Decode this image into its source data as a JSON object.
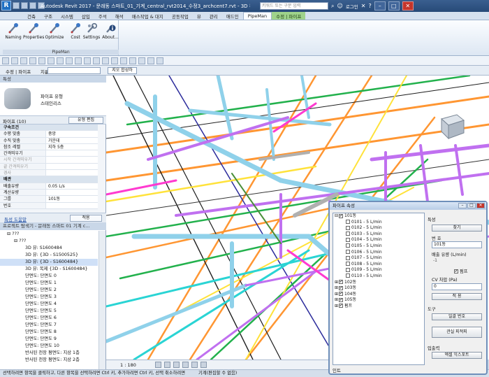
{
  "app": {
    "logo": "R",
    "title": "Autodesk Revit 2017 -    문래동 스마트_01_기계_central_rvt2014_수정3_archcent7.rvt - 3D 뷰: {3D - S1600484}",
    "search_placeholder": "키워드 또는 구문 입력",
    "user": "로그인",
    "help": "?"
  },
  "tabs": [
    "건축",
    "구조",
    "시스템",
    "삽입",
    "주석",
    "해석",
    "매스작업 & 대지",
    "공동작업",
    "뷰",
    "관리",
    "애드인",
    "PipeMan",
    "수정 | 파이프"
  ],
  "active_tab_index": 11,
  "ribbon": {
    "buttons": [
      {
        "label": "Naming",
        "icon": "wrench-icon"
      },
      {
        "label": "Properties",
        "icon": "wrench-icon"
      },
      {
        "label": "Optimize",
        "icon": "wrench-icon"
      },
      {
        "label": "Cost",
        "icon": "wrench-icon"
      },
      {
        "label": "Settings",
        "icon": "gears-icon"
      },
      {
        "label": "About...",
        "icon": "info-icon"
      }
    ],
    "panel_title": "PipeMan"
  },
  "options_bar": {
    "label": "수정 | 파이프",
    "select_label": "지름:",
    "view_button": "지오 합성하"
  },
  "properties": {
    "header": "특성",
    "type_name_1": "파이프 유형",
    "type_name_2": "스테인리스",
    "selector": "파이프 (10)",
    "edit_type": "유형 편집",
    "rows": [
      {
        "k": "구속조건",
        "v": "",
        "group": true
      },
      {
        "k": "수평 맞춤",
        "v": "중앙"
      },
      {
        "k": "수직 맞춤",
        "v": "가운데"
      },
      {
        "k": "참조 레벨",
        "v": "지하 5층"
      },
      {
        "k": "간격띄우기",
        "v": ""
      },
      {
        "k": "시작 간격띄우기",
        "v": "",
        "dim": true
      },
      {
        "k": "끝 간격띄우기",
        "v": "",
        "dim": true
      },
      {
        "k": "경사",
        "v": "",
        "dim": true
      },
      {
        "k": "배관",
        "v": "",
        "group": true
      },
      {
        "k": "배출유량",
        "v": "0.05 L/s"
      },
      {
        "k": "계산유량",
        "v": ""
      },
      {
        "k": "그룹",
        "v": "101동"
      },
      {
        "k": "번호",
        "v": ""
      }
    ],
    "help_link": "특성 도움말",
    "apply": "적용"
  },
  "browser": {
    "title": "프로젝트 탐색기 - 문래동 스마트 01 기계 c...",
    "items": [
      {
        "label": "??? ",
        "indent": 10,
        "prefix": "⊟"
      },
      {
        "label": "???",
        "indent": 20,
        "prefix": "⊟"
      },
      {
        "label": "3D 뷰: S1600484",
        "indent": 36
      },
      {
        "label": "3D 뷰: {3D - S1500525}",
        "indent": 36
      },
      {
        "label": "3D 뷰: {3D - S1600484}",
        "indent": 36,
        "sel": true
      },
      {
        "label": "3D 뷰: 복제 {3D - S1600484}",
        "indent": 36
      },
      {
        "label": "단면도: 단면도 0",
        "indent": 36
      },
      {
        "label": "단면도: 단면도 1",
        "indent": 36
      },
      {
        "label": "단면도: 단면도 2",
        "indent": 36
      },
      {
        "label": "단면도: 단면도 3",
        "indent": 36
      },
      {
        "label": "단면도: 단면도 4",
        "indent": 36
      },
      {
        "label": "단면도: 단면도 5",
        "indent": 36
      },
      {
        "label": "단면도: 단면도 6",
        "indent": 36
      },
      {
        "label": "단면도: 단면도 7",
        "indent": 36
      },
      {
        "label": "단면도: 단면도 8",
        "indent": 36
      },
      {
        "label": "단면도: 단면도 9",
        "indent": 36
      },
      {
        "label": "단면도: 단면도 10",
        "indent": 36
      },
      {
        "label": "반사된 천장 평면도: 지상 1층",
        "indent": 36
      },
      {
        "label": "반사된 천장 평면도: 지상 2층",
        "indent": 36
      }
    ]
  },
  "view": {
    "scale": "1 : 180"
  },
  "status": {
    "text": "선택하려면 항목을 클릭하고, 다른 항목을 선택하려면 Ctrl 키, 추가하려면 Ctrl 키, 선택 취소하려면",
    "right": "기계(편집할 수 없음)"
  },
  "pipeman_dialog": {
    "title": "파이프 속성",
    "tree": [
      {
        "label": "101동",
        "indent": 2,
        "exp": "⊟",
        "checked": true
      },
      {
        "label": "0101 - 5 L/min",
        "indent": 18,
        "checked": false
      },
      {
        "label": "0102 - 5 L/min",
        "indent": 18,
        "checked": false
      },
      {
        "label": "0103 - 5 L/min",
        "indent": 18,
        "checked": false
      },
      {
        "label": "0104 - 5 L/min",
        "indent": 18,
        "checked": false
      },
      {
        "label": "0105 - 5 L/min",
        "indent": 18,
        "checked": false
      },
      {
        "label": "0106 - 5 L/min",
        "indent": 18,
        "checked": false
      },
      {
        "label": "0107 - 5 L/min",
        "indent": 18,
        "checked": false
      },
      {
        "label": "0108 - 5 L/min",
        "indent": 18,
        "checked": false
      },
      {
        "label": "0109 - 5 L/min",
        "indent": 18,
        "checked": false
      },
      {
        "label": "0110 - 5 L/min",
        "indent": 18,
        "checked": false
      },
      {
        "label": "102동",
        "indent": 2,
        "exp": "⊞",
        "checked": true
      },
      {
        "label": "103동",
        "indent": 2,
        "exp": "⊞",
        "checked": true
      },
      {
        "label": "104동",
        "indent": 2,
        "exp": "⊞",
        "checked": true
      },
      {
        "label": "105동",
        "indent": 2,
        "exp": "⊞",
        "checked": true
      },
      {
        "label": "펌프",
        "indent": 2,
        "exp": "⊞",
        "checked": true
      }
    ],
    "footer": "인트",
    "side": {
      "section_props": "특성",
      "find_btn": "찾기",
      "number_label": "번 호",
      "number_value": "101동",
      "flow_label": "배출 유량 (L/min)",
      "flow_value": "-1",
      "pump_label": "펌프",
      "cv_label": "CV 차압 (Pa)",
      "cv_value": "0",
      "apply_btn": "적 용",
      "section_tools": "도구",
      "auto_number_btn": "일괄 번호",
      "create_group_btn": "관실 피적피",
      "section_io": "입출력",
      "excel_btn": "엑셀 익스포트"
    }
  }
}
